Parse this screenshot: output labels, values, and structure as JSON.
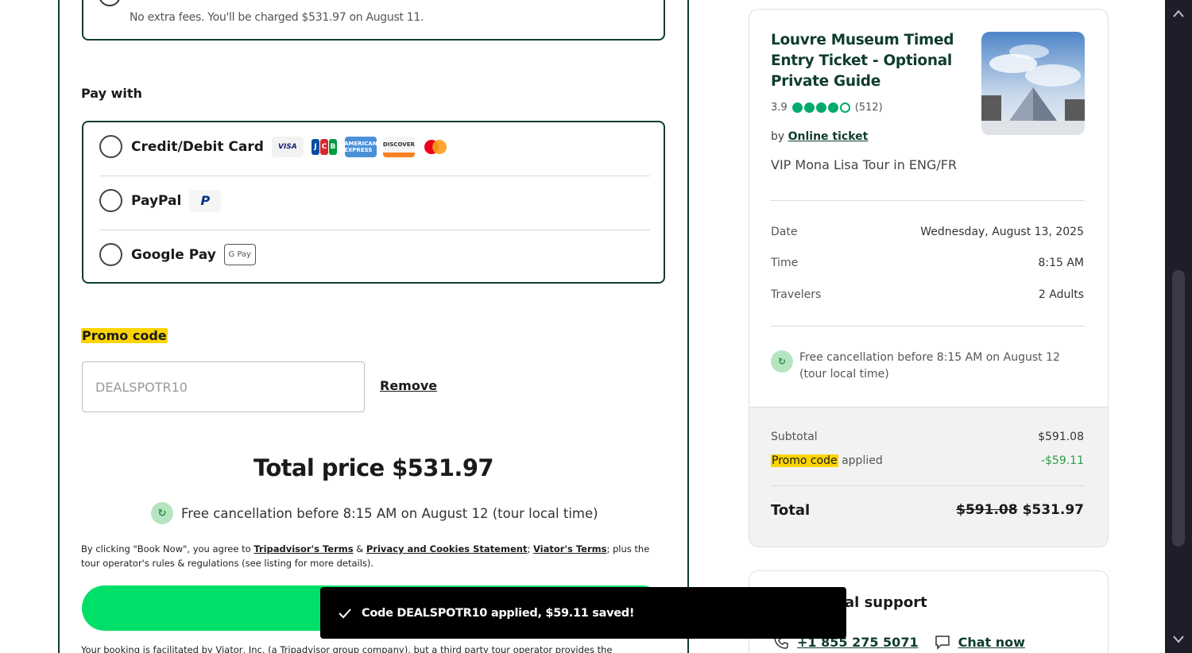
{
  "checkout": {
    "fee_note": "No extra fees. You'll be charged $531.97 on August 11.",
    "pay_with_label": "Pay with",
    "payment_methods": [
      {
        "label": "Credit/Debit Card",
        "icons": [
          "visa-icon",
          "jcb-icon",
          "amex-icon",
          "discover-icon",
          "mastercard-icon"
        ]
      },
      {
        "label": "PayPal",
        "icons": [
          "paypal-icon"
        ]
      },
      {
        "label": "Google Pay",
        "icons": [
          "google-pay-icon"
        ]
      }
    ],
    "card_icon_text": {
      "visa": "VISA",
      "amex": "AMERICAN EXPRESS",
      "discover": "DISCOVER",
      "paypal": "P",
      "gpay": "G Pay"
    },
    "promo_label": "Promo code",
    "promo_value": "DEALSPOTR10",
    "remove_label": "Remove",
    "total_price": "Total price $531.97",
    "cancel_text": "Free cancellation before 8:15 AM on August 12 (tour local time)",
    "terms": {
      "intro": "By clicking \"Book Now\", you agree to ",
      "link1": "Tripadvisor's Terms",
      "amp": " & ",
      "link2": "Privacy and Cookies Statement",
      "sep": "; ",
      "link3": "Viator's Terms",
      "outro": "; plus the tour operator's rules & regulations (see listing for more details)."
    },
    "bottom_note": "Your booking is facilitated by Viator, Inc. (a Tripadvisor group company), but a third party tour operator provides the"
  },
  "toast": {
    "text": "Code DEALSPOTR10 applied, $59.11 saved!"
  },
  "summary": {
    "tour_title": "Louvre Museum Timed Entry Ticket - Optional Private Guide",
    "rating": "3.9",
    "rating_bubbles": 3.9,
    "review_count": "(512)",
    "by_prefix": "by ",
    "operator": "Online ticket",
    "option_name": "VIP Mona Lisa Tour in ENG/FR",
    "details": [
      {
        "label": "Date",
        "value": "Wednesday, August 13, 2025"
      },
      {
        "label": "Time",
        "value": "8:15 AM"
      },
      {
        "label": "Travelers",
        "value": "2 Adults"
      }
    ],
    "cancel_text": "Free cancellation before 8:15 AM on August 12 (tour local time)",
    "subtotal_label": "Subtotal",
    "subtotal_value": "$591.08",
    "promo_tag": "Promo code",
    "promo_suffix": " applied",
    "promo_value": "-$59.11",
    "total_label": "Total",
    "total_old": "$591.08",
    "total_new": "$531.97"
  },
  "support": {
    "title": "al support",
    "phone": "+1 855 275 5071",
    "chat": "Chat now"
  },
  "colors": {
    "brand_dark_green": "#0f3d2b",
    "book_button_green": "#00e069",
    "highlight_yellow": "#fcd403",
    "discount_green": "#2a9d4a",
    "rating_green": "#00aa6c"
  }
}
